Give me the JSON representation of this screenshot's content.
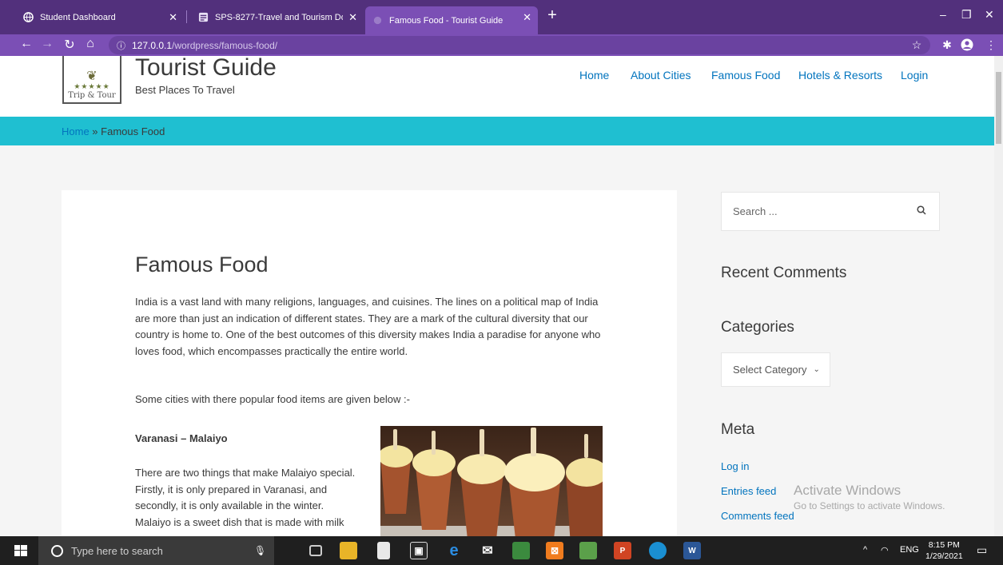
{
  "browser": {
    "tabs": [
      {
        "title": "Student Dashboard",
        "active": false
      },
      {
        "title": "SPS-8277-Travel and Tourism Do",
        "active": false
      },
      {
        "title": "Famous Food - Tourist Guide",
        "active": true
      }
    ],
    "url_host": "127.0.0.1",
    "url_path": "/wordpress/famous-food/"
  },
  "site": {
    "logo_stars": "★★★★★",
    "logo_text": "Trip & Tour",
    "title": "Tourist Guide",
    "tagline": "Best Places To Travel",
    "nav": [
      "Home",
      "About Cities",
      "Famous Food",
      "Hotels & Resorts",
      "Login"
    ]
  },
  "breadcrumb": {
    "home": "Home",
    "separator": " » ",
    "current": "Famous Food"
  },
  "article": {
    "title": "Famous Food",
    "intro": "India is a vast land with many religions, languages, and cuisines. The lines on a political map of India are more than just an indication of different states. They are a mark of the cultural diversity that our country is home to. One of the best outcomes of this diversity makes India a paradise for anyone who loves food, which encompasses practically the entire world.",
    "lead": "Some cities with there popular food items are given below :-",
    "section_heading": "Varanasi – Malaiyo",
    "section_text": "There are two things that make Malaiyo special. Firstly, it is only prepared in Varanasi, and secondly, it is only available in the winter. Malaiyo is a sweet dish that is made with milk"
  },
  "sidebar": {
    "search_placeholder": "Search ...",
    "recent_comments_title": "Recent Comments",
    "categories_title": "Categories",
    "category_select": "Select Category",
    "meta_title": "Meta",
    "meta_links": [
      "Log in",
      "Entries feed",
      "Comments feed"
    ]
  },
  "watermark": {
    "line1": "Activate Windows",
    "line2": "Go to Settings to activate Windows."
  },
  "taskbar": {
    "search_placeholder": "Type here to search",
    "lang": "ENG",
    "time": "8:15 PM",
    "date": "1/29/2021"
  },
  "colors": {
    "browser_frame": "#52307c",
    "toolbar": "#7b4fb5",
    "accent_bar": "#1fbfd1",
    "link": "#0274be"
  }
}
